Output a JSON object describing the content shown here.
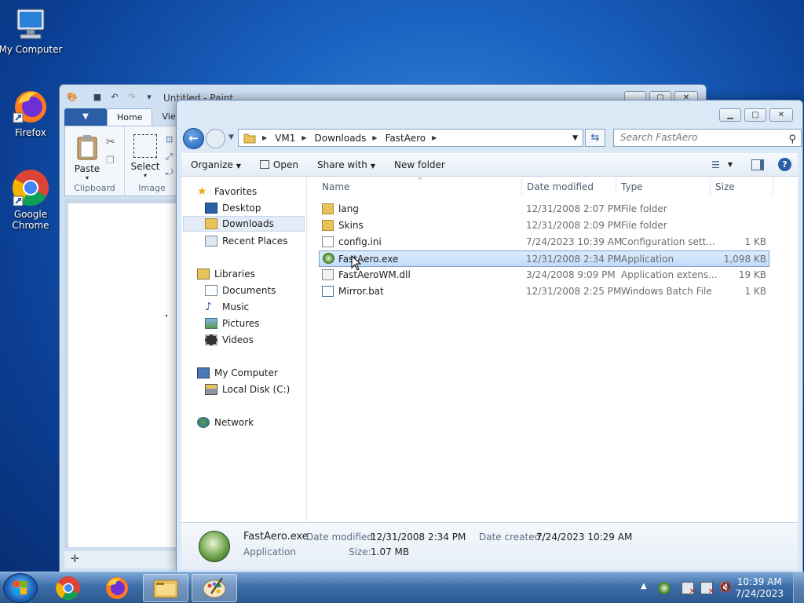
{
  "desktop": {
    "icons": [
      {
        "label": "My Computer",
        "icon": "computer-icon"
      },
      {
        "label": "Firefox",
        "icon": "firefox-icon"
      },
      {
        "label": "Google Chrome",
        "icon": "chrome-icon"
      }
    ]
  },
  "paint": {
    "title": "Untitled - Paint",
    "file_tab": "▼",
    "tabs": [
      "Home",
      "View"
    ],
    "groups": {
      "clipboard": {
        "label": "Clipboard",
        "paste": "Paste"
      },
      "image": {
        "label": "Image",
        "select": "Select"
      }
    }
  },
  "explorer": {
    "address": {
      "segments": [
        "VM1",
        "Downloads",
        "FastAero"
      ]
    },
    "search_placeholder": "Search FastAero",
    "toolbar": {
      "organize": "Organize",
      "open": "Open",
      "share_with": "Share with",
      "new_folder": "New folder"
    },
    "nav": {
      "favorites": "Favorites",
      "desktop": "Desktop",
      "downloads": "Downloads",
      "recent_places": "Recent Places",
      "libraries": "Libraries",
      "documents": "Documents",
      "music": "Music",
      "pictures": "Pictures",
      "videos": "Videos",
      "my_computer": "My Computer",
      "local_disk": "Local Disk (C:)",
      "network": "Network"
    },
    "columns": {
      "name": "Name",
      "date_modified": "Date modified",
      "type": "Type",
      "size": "Size"
    },
    "files": [
      {
        "name": "lang",
        "date": "12/31/2008 2:07 PM",
        "type": "File folder",
        "size": "",
        "icon": "folder-icon"
      },
      {
        "name": "Skins",
        "date": "12/31/2008 2:09 PM",
        "type": "File folder",
        "size": "",
        "icon": "folder-icon"
      },
      {
        "name": "config.ini",
        "date": "7/24/2023 10:39 AM",
        "type": "Configuration sett...",
        "size": "1 KB",
        "icon": "ini-file-icon"
      },
      {
        "name": "FastAero.exe",
        "date": "12/31/2008 2:34 PM",
        "type": "Application",
        "size": "1,098 KB",
        "icon": "exe-app-icon"
      },
      {
        "name": "FastAeroWM.dll",
        "date": "3/24/2008 9:09 PM",
        "type": "Application extens...",
        "size": "19 KB",
        "icon": "dll-file-icon"
      },
      {
        "name": "Mirror.bat",
        "date": "12/31/2008 2:25 PM",
        "type": "Windows Batch File",
        "size": "1 KB",
        "icon": "bat-file-icon"
      }
    ],
    "details": {
      "name": "FastAero.exe",
      "type": "Application",
      "date_modified_label": "Date modified:",
      "date_modified": "12/31/2008 2:34 PM",
      "size_label": "Size:",
      "size": "1.07 MB",
      "date_created_label": "Date created:",
      "date_created": "7/24/2023 10:29 AM"
    }
  },
  "taskbar": {
    "time": "10:39 AM",
    "date": "7/24/2023",
    "apps": [
      "chrome-icon",
      "firefox-icon",
      "explorer-icon",
      "paint-icon"
    ]
  },
  "colors": {
    "accent": "#2a5fa8",
    "selection": "#c1dcfa"
  }
}
